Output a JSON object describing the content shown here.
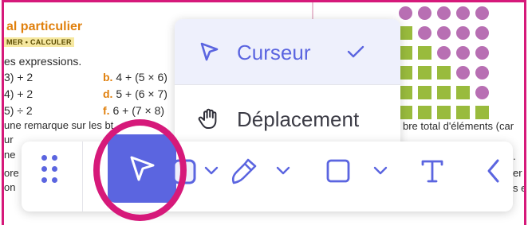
{
  "document": {
    "title": "al particulier",
    "tag": "MER • CALCULER",
    "instruction": "es expressions.",
    "expressions_left": [
      "3) + 2",
      "4) + 2",
      "5) ÷ 2"
    ],
    "expressions_right": [
      {
        "letter": "b.",
        "text": "4 + (5 × 6)"
      },
      {
        "letter": "d.",
        "text": "5 + (6 × 7)"
      },
      {
        "letter": "f.",
        "text": "6 + (7 × 8)"
      }
    ],
    "para_fragments": [
      "une remarque sur les bt",
      "ur",
      "ne",
      "ore",
      "on"
    ],
    "right_fragments": [
      "bre total d'éléments (car",
      "ts.",
      "er l",
      "s er"
    ]
  },
  "menu": {
    "items": [
      {
        "label": "Curseur",
        "icon": "cursor-icon",
        "selected": true
      },
      {
        "label": "Déplacement",
        "icon": "hand-icon",
        "selected": false
      }
    ]
  },
  "toolbar": {
    "tools": [
      {
        "name": "drag-handle-icon"
      },
      {
        "name": "cursor-tool",
        "active": true
      },
      {
        "name": "pen-tool"
      },
      {
        "name": "shape-tool"
      },
      {
        "name": "text-tool"
      },
      {
        "name": "collapse-chevron-icon"
      }
    ]
  },
  "colors": {
    "accent": "#5b65e0",
    "highlight": "#d6197a",
    "dots": "#b86fb3",
    "squares": "#99bb3d"
  }
}
